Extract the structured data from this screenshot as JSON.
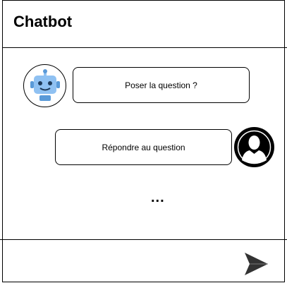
{
  "header": {
    "title": "Chatbot"
  },
  "messages": [
    {
      "sender": "bot",
      "avatar_icon": "robot-icon",
      "text": "Poser la question ?"
    },
    {
      "sender": "user",
      "avatar_icon": "user-icon",
      "text": "Répondre au question"
    }
  ],
  "typing_indicator": "...",
  "composer": {
    "send_icon": "send-icon"
  },
  "colors": {
    "robot_body": "#8fc1f2",
    "robot_face": "#5a9ad8",
    "send_icon": "#333333"
  }
}
